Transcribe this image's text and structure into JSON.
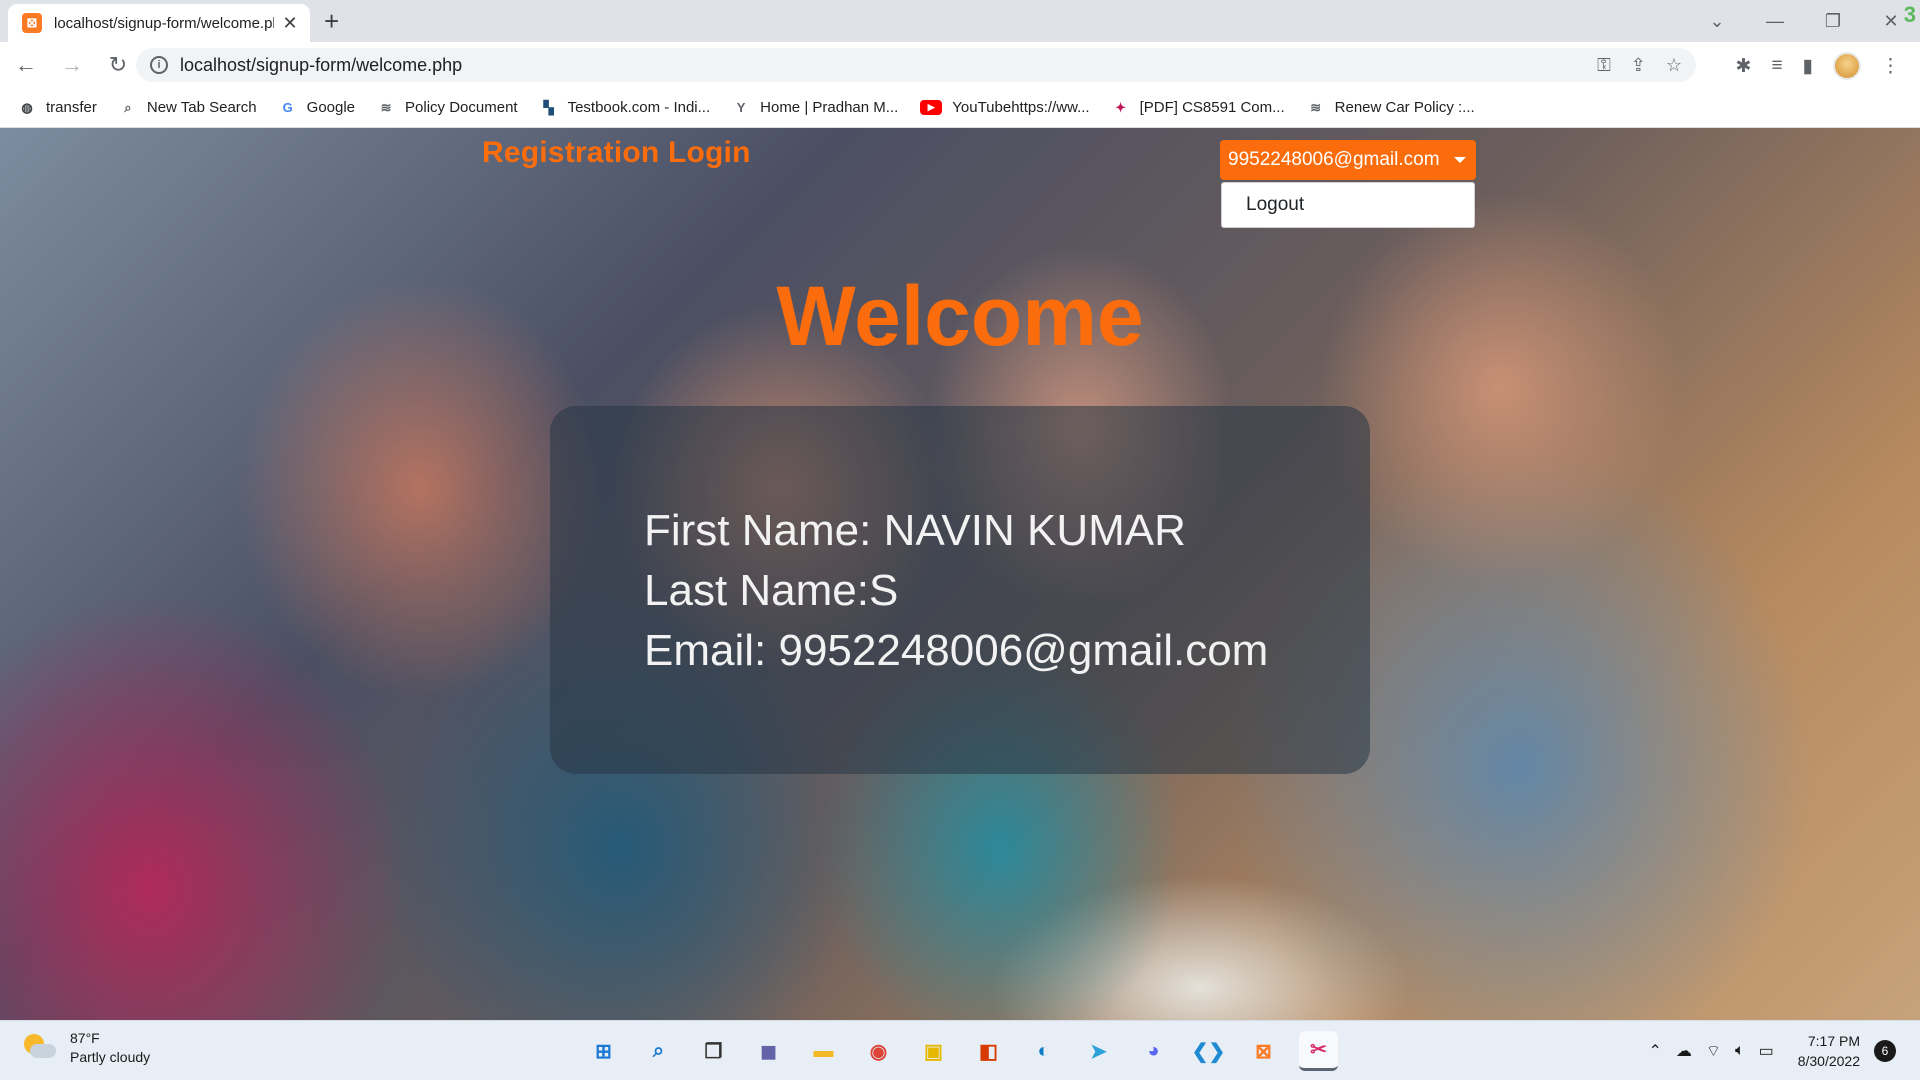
{
  "browser": {
    "tab_title": "localhost/signup-form/welcome.php",
    "tab_close": "✕",
    "new_tab": "+",
    "url": "localhost/signup-form/welcome.php",
    "window_badge": "3",
    "bookmarks": [
      {
        "label": "transfer",
        "icon": "globe-icon"
      },
      {
        "label": "New Tab Search",
        "icon": "search-icon"
      },
      {
        "label": "Google",
        "icon": "google-icon"
      },
      {
        "label": "Policy Document",
        "icon": "layers-icon"
      },
      {
        "label": "Testbook.com - Indi...",
        "icon": "testbook-icon"
      },
      {
        "label": "Home | Pradhan M...",
        "icon": "pradhan-icon"
      },
      {
        "label": "YouTubehttps://ww...",
        "icon": "youtube-icon"
      },
      {
        "label": "[PDF] CS8591 Com...",
        "icon": "pdf-icon"
      },
      {
        "label": "Renew Car Policy :...",
        "icon": "layers-icon"
      }
    ]
  },
  "page": {
    "brand": "Registration Login",
    "user_menu": {
      "label": "9952248006@gmail.com",
      "items": [
        "Logout"
      ]
    },
    "heading": "Welcome",
    "info": {
      "first_name": "First Name: NAVIN KUMAR",
      "last_name": "Last Name:S",
      "email": "Email: 9952248006@gmail.com"
    },
    "accent_color": "#fb6c0c"
  },
  "taskbar": {
    "weather_temp": "87°F",
    "weather_desc": "Partly cloudy",
    "time": "7:17 PM",
    "date": "8/30/2022",
    "notification_count": "6",
    "apps": [
      "windows-start-icon",
      "search-icon",
      "task-view-icon",
      "teams-icon",
      "file-explorer-icon",
      "chrome-icon",
      "sticky-notes-icon",
      "office-icon",
      "edge-icon",
      "telegram-icon",
      "discord-icon",
      "vscode-icon",
      "xampp-icon",
      "snipping-tool-icon"
    ]
  }
}
